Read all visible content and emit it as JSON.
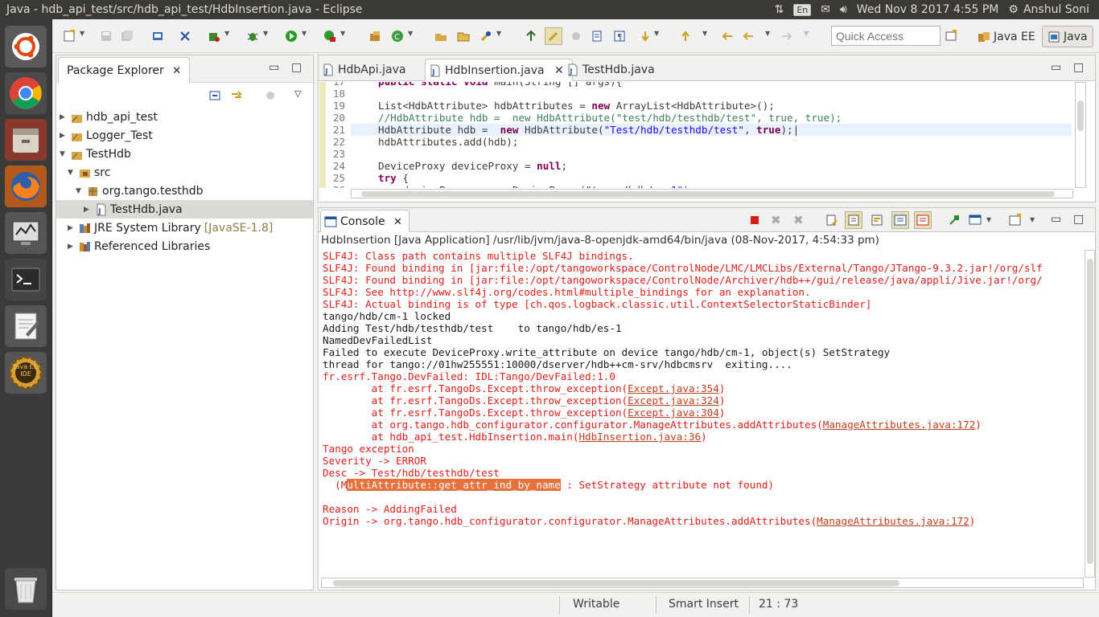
{
  "topbar": {
    "title": "Java - hdb_api_test/src/hdb_api_test/HdbInsertion.java - Eclipse",
    "lang": "En",
    "datetime": "Wed Nov  8 2017  4:55 PM",
    "user": "Anshul Soni"
  },
  "launcher": {
    "items": [
      "ubuntu-dash-icon",
      "chrome-icon",
      "files-icon",
      "firefox-icon",
      "system-monitor-icon",
      "terminal-icon",
      "text-editor-icon",
      "eclipse-javaee-icon",
      "trash-icon"
    ],
    "javaee_label": "Java EE IDE"
  },
  "toolbar": {
    "quick_access_placeholder": "Quick Access",
    "perspective_javaee": "Java EE",
    "perspective_java": "Java"
  },
  "package_explorer": {
    "title": "Package Explorer",
    "tree": [
      {
        "label": "hdb_api_test",
        "suffix": ""
      },
      {
        "label": "Logger_Test",
        "suffix": ""
      },
      {
        "label": "TestHdb",
        "suffix": ""
      },
      {
        "label": "src",
        "suffix": ""
      },
      {
        "label": "org.tango.testhdb",
        "suffix": ""
      },
      {
        "label": "TestHdb.java",
        "suffix": ""
      },
      {
        "label": "JRE System Library",
        "suffix": "[JavaSE-1.8]"
      },
      {
        "label": "Referenced Libraries",
        "suffix": ""
      }
    ]
  },
  "editor": {
    "tabs": [
      "HdbApi.java",
      "HdbInsertion.java",
      "TestHdb.java"
    ],
    "line_numbers": [
      "17",
      "18",
      "19",
      "20",
      "21",
      "22",
      "23",
      "24",
      "25",
      "26"
    ]
  },
  "console": {
    "title": "Console",
    "header": "HdbInsertion [Java Application] /usr/lib/jvm/java-8-openjdk-amd64/bin/java (08-Nov-2017, 4:54:33 pm)",
    "lines": [
      "SLF4J: Class path contains multiple SLF4J bindings.",
      "SLF4J: Found binding in [jar:file:/opt/tangoworkspace/ControlNode/LMC/LMCLibs/External/Tango/JTango-9.3.2.jar!/org/slf",
      "SLF4J: Found binding in [jar:file:/opt/tangoworkspace/ControlNode/Archiver/hdb++/gui/release/java/appli/Jive.jar!/org/",
      "SLF4J: See http://www.slf4j.org/codes.html#multiple_bindings for an explanation.",
      "SLF4J: Actual binding is of type [ch.qos.logback.classic.util.ContextSelectorStaticBinder]",
      "tango/hdb/cm-1 locked",
      "Adding Test/hdb/testhdb/test    to tango/hdb/es-1",
      "NamedDevFailedList",
      "Failed to execute DeviceProxy.write_attribute on device tango/hdb/cm-1, object(s) SetStrategy",
      "thread for tango://01hw255551:10000/dserver/hdb++cm-srv/hdbcmsrv  exiting....",
      "fr.esrf.Tango.DevFailed: IDL:Tango/DevFailed:1.0",
      "        at fr.esrf.TangoDs.Except.throw_exception(",
      "        at fr.esrf.TangoDs.Except.throw_exception(",
      "        at fr.esrf.TangoDs.Except.throw_exception(",
      "        at org.tango.hdb_configurator.configurator.ManageAttributes.addAttributes(",
      "        at hdb_api_test.HdbInsertion.main(",
      "Tango exception",
      "Severity -> ERROR",
      "Desc -> Test/hdb/testhdb/test",
      "  (M",
      "",
      "Reason -> AddingFailed",
      "Origin -> org.tango.hdb_configurator.configurator.ManageAttributes.addAttributes("
    ],
    "links": [
      "Except.java:354",
      "Except.java:324",
      "Except.java:304",
      "ManageAttributes.java:172",
      "HdbInsertion.java:36",
      "ManageAttributes.java:172"
    ],
    "highlight": "ultiAttribute::get_attr_ind_by_name",
    "highlight_rest": " : SetStrategy attribute not found)"
  },
  "status": {
    "writable": "Writable",
    "insert_mode": "Smart Insert",
    "position": "21 : 73"
  }
}
